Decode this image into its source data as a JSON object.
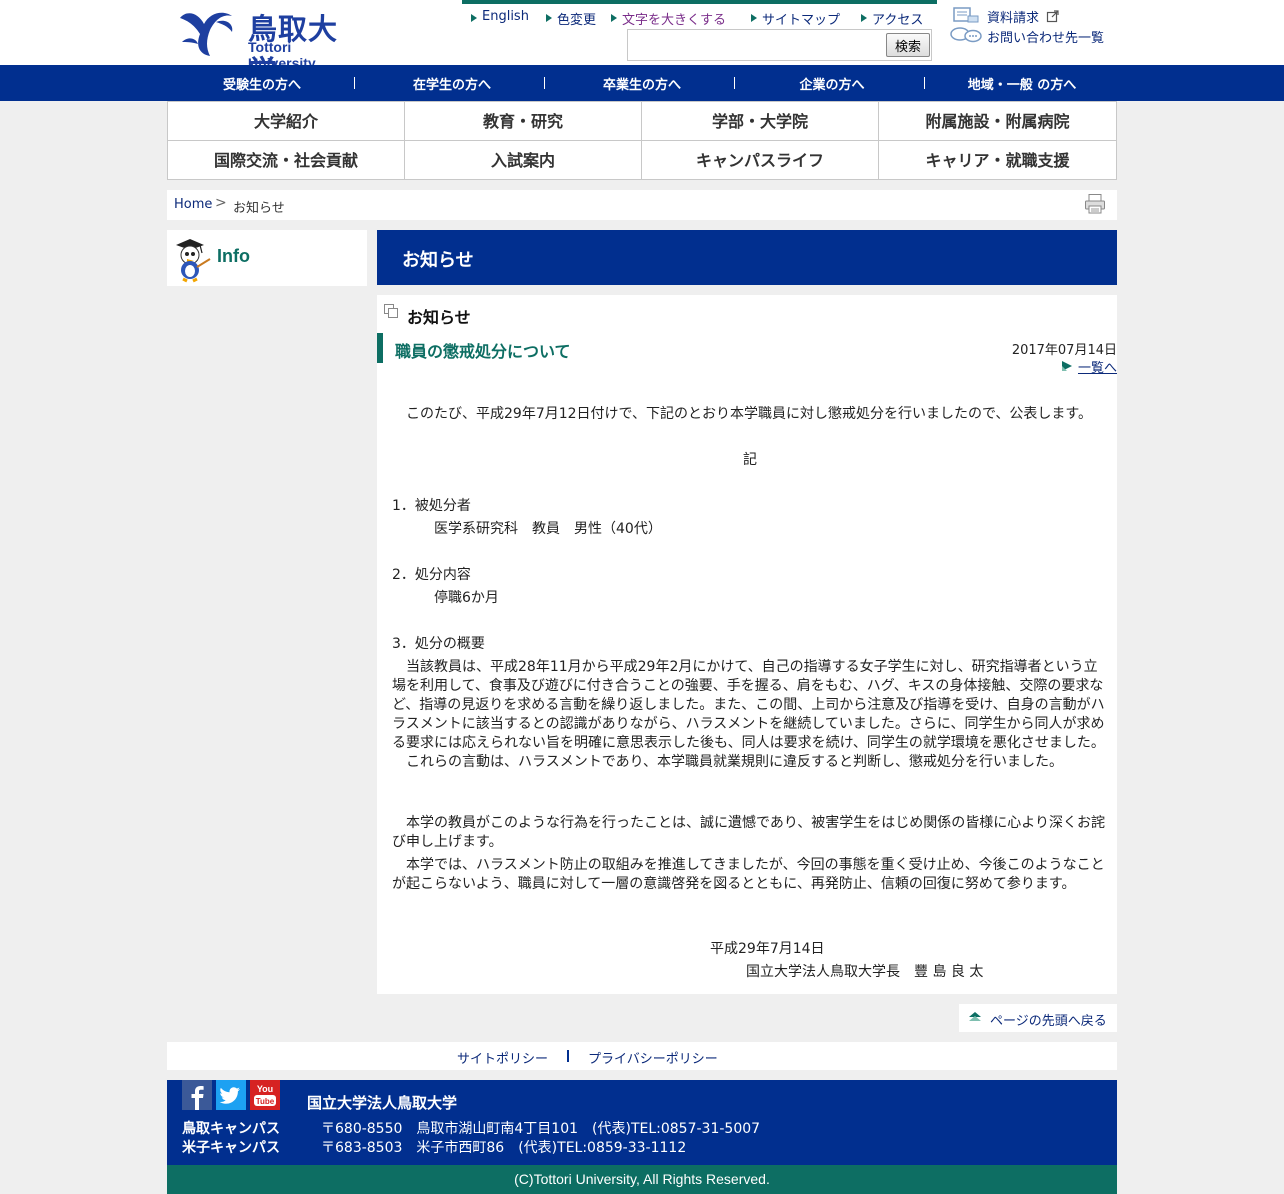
{
  "header": {
    "logo_ja": "鳥取大学",
    "logo_en": "Tottori University",
    "util_links": [
      "English",
      "色変更",
      "文字を大きくする",
      "サイトマップ",
      "アクセス"
    ],
    "search_placeholder": "",
    "search_button": "検索",
    "request_materials": "資料請求",
    "contact_list": "お問い合わせ先一覧"
  },
  "bluenav": [
    "受験生の方へ",
    "在学生の方へ",
    "卒業生の方へ",
    "企業の方へ",
    "地域・一般 の方へ"
  ],
  "gridmenu": [
    "大学紹介",
    "教育・研究",
    "学部・大学院",
    "附属施設・附属病院",
    "国際交流・社会貢献",
    "入試案内",
    "キャンパスライフ",
    "キャリア・就職支援"
  ],
  "breadcrumb": {
    "home": "Home",
    "sep": ">",
    "current": "お知らせ"
  },
  "sidebar": {
    "info_label": "Info"
  },
  "main": {
    "page_title": "お知らせ",
    "section_title": "お知らせ",
    "news_title": "職員の懲戒処分について",
    "news_date": "2017年07月14日",
    "back_link": "一覧へ",
    "intro": "　このたび、平成29年7月12日付けで、下記のとおり本学職員に対し懲戒処分を行いましたので、公表します。",
    "ki": "記",
    "item1_head": "1．被処分者",
    "item1_body": "医学系研究科　教員　男性（40代）",
    "item2_head": "2．処分内容",
    "item2_body": "停職6か月",
    "item3_head": "3．処分の概要",
    "item3_p1": "　当該教員は、平成28年11月から平成29年2月にかけて、自己の指導する女子学生に対し、研究指導者という立場を利用して、食事及び遊びに付き合うことの強要、手を握る、肩をもむ、ハグ、キスの身体接触、交際の要求など、指導の見返りを求める言動を繰り返しました。また、この間、上司から注意及び指導を受け、自身の言動がハラスメントに該当するとの認識がありながら、ハラスメントを継続していました。さらに、同学生から同人が求める要求には応えられない旨を明確に意思表示した後も、同人は要求を続け、同学生の就学環境を悪化させました。",
    "item3_p2": "　これらの言動は、ハラスメントであり、本学職員就業規則に違反すると判断し、懲戒処分を行いました。",
    "apology_p1": "　本学の教員がこのような行為を行ったことは、誠に遺憾であり、被害学生をはじめ関係の皆様に心より深くお詫び申し上げます。",
    "apology_p2": "　本学では、ハラスメント防止の取組みを推進してきましたが、今回の事態を重く受け止め、今後このようなことが起こらないよう、職員に対して一層の意識啓発を図るとともに、再発防止、信頼の回復に努めて参ります。",
    "sign_date": "平成29年7月14日",
    "sign_name": "国立大学法人鳥取大学長　豐 島  良 太"
  },
  "pagetop": "ページの先頭へ戻る",
  "policy": {
    "site_policy": "サイトポリシー",
    "privacy_policy": "プライバシーポリシー"
  },
  "footer": {
    "org_name": "国立大学法人鳥取大学",
    "campus1": "鳥取キャンパス",
    "addr1": "〒680-8550　鳥取市湖山町南4丁目101　(代表)TEL:0857-31-5007",
    "campus2": "米子キャンパス",
    "addr2": "〒683-8503　米子市西町86　(代表)TEL:0859-33-1112",
    "copyright": "(C)Tottori University, All Rights Reserved.",
    "sns": [
      "facebook-icon",
      "twitter-icon",
      "youtube-icon"
    ]
  },
  "colors": {
    "navy": "#012f8f",
    "teal": "#0d6e63",
    "link": "#0c2a7a",
    "bg": "#efefef"
  }
}
